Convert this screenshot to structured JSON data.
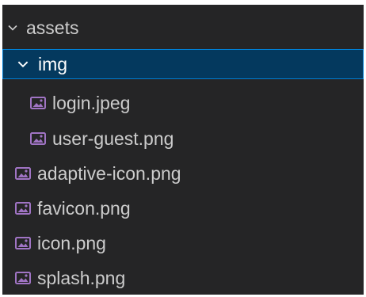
{
  "explorer": {
    "items": [
      {
        "label": "assets",
        "icon": "chevron-down-icon"
      },
      {
        "label": "img",
        "icon": "chevron-down-icon"
      },
      {
        "label": "login.jpeg",
        "icon": "image-file-icon"
      },
      {
        "label": "user-guest.png",
        "icon": "image-file-icon"
      },
      {
        "label": "adaptive-icon.png",
        "icon": "image-file-icon"
      },
      {
        "label": "favicon.png",
        "icon": "image-file-icon"
      },
      {
        "label": "icon.png",
        "icon": "image-file-icon"
      },
      {
        "label": "splash.png",
        "icon": "image-file-icon"
      }
    ]
  },
  "colors": {
    "background": "#252526",
    "text": "#cccccc",
    "selection_background": "#04395e",
    "selection_border": "#007fd4",
    "image_icon": "#a074c4"
  }
}
